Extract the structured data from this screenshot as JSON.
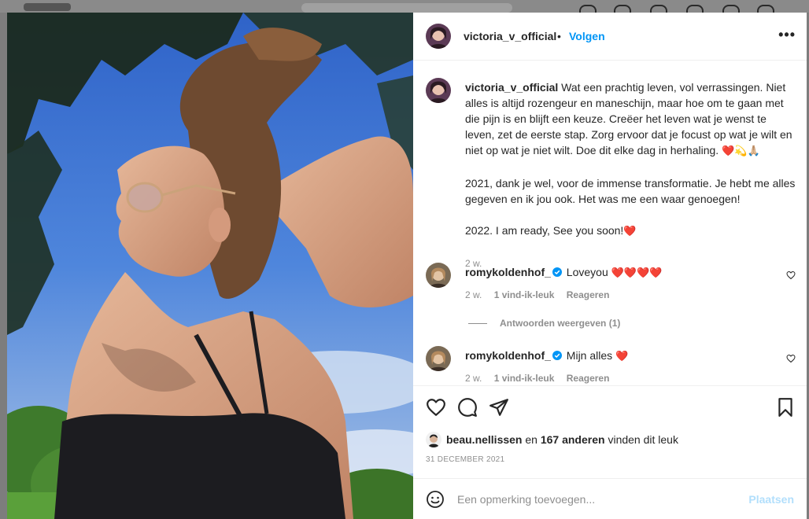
{
  "post": {
    "author": "victoria_v_official",
    "follow_label": "Volgen",
    "dot": "•",
    "more": "•••",
    "caption": {
      "username": "victoria_v_official",
      "paragraph_1": "Wat een prachtig leven, vol verrassingen. Niet alles is altijd rozengeur en maneschijn, maar hoe om te gaan met die pijn is en blijft een keuze. Creëer het leven wat je wenst te leven, zet de eerste stap. Zorg ervoor dat je focust op wat je wilt en niet op wat je niet wilt. Doe dit elke dag in herhaling.",
      "paragraph_1_emoji": "❤️💫🙏🏼",
      "paragraph_2": "2021, dank je wel, voor de immense transformatie. Je hebt me alles gegeven en ik jou ook. Het was me een waar genoegen!",
      "paragraph_3": "2022. I am ready, See you soon!",
      "paragraph_3_emoji": "❤️",
      "time": "2 w."
    },
    "comments": [
      {
        "username": "romykoldenhof_",
        "text": "Loveyou",
        "emoji": "❤️❤️❤️❤️",
        "time": "2 w.",
        "likes": "1 vind-ik-leuk",
        "reply": "Reageren",
        "view_replies": "Antwoorden weergeven (1)"
      },
      {
        "username": "romykoldenhof_",
        "text": "Mijn alles",
        "emoji": "❤️",
        "time": "2 w.",
        "likes": "1 vind-ik-leuk",
        "reply": "Reageren"
      }
    ],
    "liked_by": {
      "user": "beau.nellissen",
      "and": "en",
      "others": "167 anderen",
      "suffix": "vinden dit leuk"
    },
    "date": "31 DECEMBER 2021",
    "add_comment": {
      "placeholder": "Een opmerking toevoegen...",
      "post_label": "Plaatsen"
    }
  },
  "colors": {
    "accent": "#0095f6",
    "muted": "#8e8e8e",
    "text": "#262626",
    "post_disabled": "#b2dffc"
  }
}
